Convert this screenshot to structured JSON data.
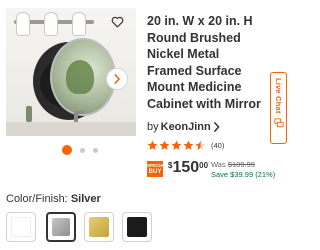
{
  "product": {
    "title": "20 in. W x 20 in. H Round Brushed Nickel Metal Framed Surface Mount Medicine Cabinet with Mirror",
    "brand_prefix": "by",
    "brand": "KeonJinn",
    "rating": 4.5,
    "review_count": "(40)",
    "badge_line1": "SPECIAL",
    "badge_line2": "BUY",
    "price_currency": "$",
    "price_dollars": "150",
    "price_cents": "00",
    "was_label": "Was",
    "was_price": "$189.99",
    "save_text": "Save $39.99 (21%)"
  },
  "gallery": {
    "dot_count": 3,
    "active_index": 0
  },
  "live_chat": {
    "label": "Live Chat"
  },
  "finish": {
    "label": "Color/Finish:",
    "selected": "Silver",
    "swatches": [
      {
        "name": "White",
        "color": "#ffffff"
      },
      {
        "name": "Silver",
        "color": "#a9a9a9"
      },
      {
        "name": "Gold",
        "color": "#d4b955"
      },
      {
        "name": "Black",
        "color": "#1b1b1b"
      }
    ]
  },
  "colors": {
    "accent": "#f96302",
    "star": "#f96302",
    "save_green": "#00783e"
  },
  "icons": [
    "heart-icon",
    "chevron-right-icon",
    "star-icon",
    "chat-icon"
  ]
}
